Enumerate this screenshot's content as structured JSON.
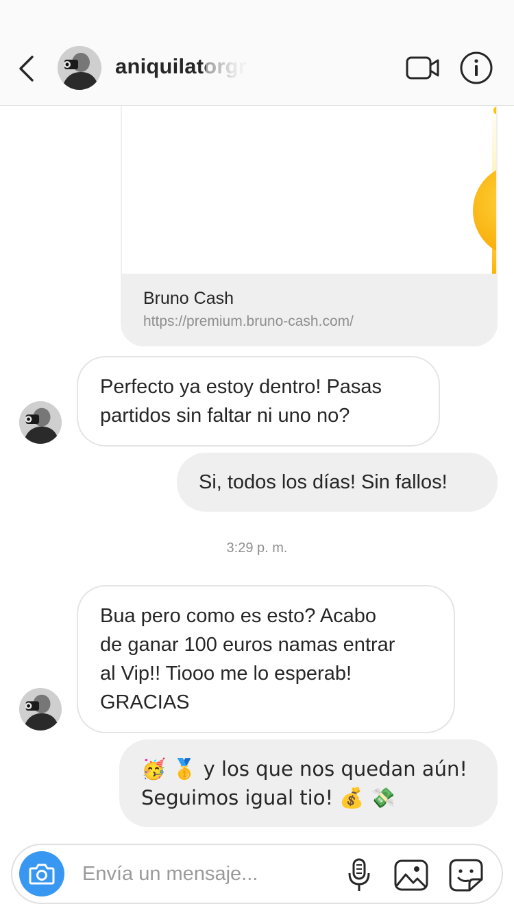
{
  "header": {
    "contact_name": "aniquilatorgr",
    "back_icon": "chevron-left-icon",
    "video_icon": "video-camera-icon",
    "info_icon": "info-icon"
  },
  "link_card": {
    "title": "Bruno Cash",
    "url": "https://premium.bruno-cash.com/"
  },
  "messages": [
    {
      "direction": "incoming",
      "lines": [
        "Perfecto ya estoy dentro! Pasas",
        "partidos sin faltar ni uno no?"
      ]
    },
    {
      "direction": "outgoing",
      "lines": [
        "Si, todos los días! Sin fallos!"
      ]
    },
    {
      "direction": "incoming",
      "lines": [
        "Bua pero como es esto? Acabo",
        "de ganar 100 euros namas entrar",
        "al Vip!! Tiooo me lo esperab!",
        "GRACIAS"
      ]
    },
    {
      "direction": "outgoing",
      "lines": [
        "🥳 🥇  y los que nos quedan aún!",
        "Seguimos igual tio! 💰 💸"
      ]
    }
  ],
  "timestamp": "3:29 p. m.",
  "composer": {
    "placeholder": "Envía un mensaje...",
    "camera_icon": "camera-icon",
    "mic_icon": "microphone-icon",
    "gallery_icon": "image-icon",
    "sticker_icon": "sticker-icon"
  },
  "colors": {
    "accent": "#3897f0",
    "outgoing_bubble": "#efefef",
    "incoming_border": "#e4e4e4",
    "muted_text": "#8e8e8e"
  }
}
